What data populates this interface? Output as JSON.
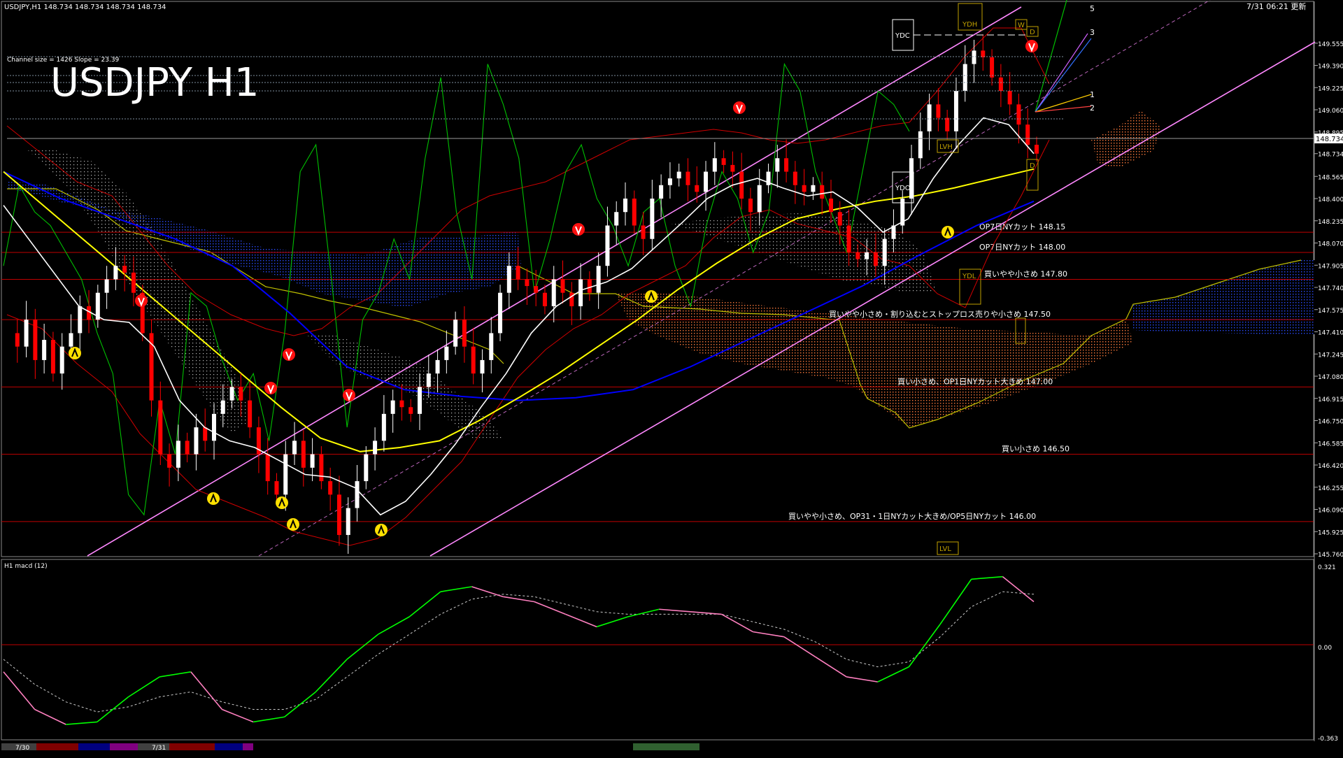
{
  "header": {
    "symbol_line": "USDJPY,H1  148.734 148.734 148.734 148.734",
    "update_label": "7/31 06:21 更新",
    "channel_info": "Channel size = 1426 Slope = 23.39",
    "big_title": "USDJPY H1"
  },
  "colors": {
    "background": "#000000",
    "grid": "#808080",
    "up_candle": "#ffffff",
    "down_candle": "#ff0000",
    "level_line": "#c00000",
    "channel": "#ff88ff",
    "ma_fast": "#ffffff",
    "ma_mid": "#ffff00",
    "ma_slow": "#0000ff",
    "chikou": "#00c000",
    "macd_up": "#00ff00",
    "macd_down": "#ff80c0",
    "signal": "#cccccc",
    "cloud_blue": "#2040ff",
    "cloud_orange": "#ff8040"
  },
  "chart_data": {
    "type": "candlestick",
    "symbol": "USDJPY",
    "timeframe": "H1",
    "ylim": [
      145.76,
      149.72
    ],
    "current_price": 148.734,
    "y_ticks": [
      "149.555",
      "149.390",
      "149.225",
      "149.060",
      "148.895",
      "148.734",
      "148.565",
      "148.400",
      "148.235",
      "148.070",
      "147.905",
      "147.740",
      "147.575",
      "147.410",
      "147.245",
      "147.080",
      "146.915",
      "146.750",
      "146.585",
      "146.420",
      "146.255",
      "146.090",
      "145.925",
      "145.760"
    ],
    "x_labels": [
      "7/30",
      "7/31"
    ],
    "levels": [
      {
        "price": 148.15,
        "label": "OP7日NYカット 148.15"
      },
      {
        "price": 148.0,
        "label": "OP7日NYカット 148.00"
      },
      {
        "price": 147.8,
        "label": "買いやや小さめ 147.80"
      },
      {
        "price": 147.5,
        "label": "買いやや小さめ・割り込むとストップロス売りや小さめ 147.50"
      },
      {
        "price": 147.0,
        "label": "買い小さめ、OP1日NYカット大きめ 147.00"
      },
      {
        "price": 146.5,
        "label": "買い小さめ 146.50"
      },
      {
        "price": 146.0,
        "label": "買いやや小さめ、OP31・1日NYカット大きめ/OP5日NYカット 146.00"
      }
    ],
    "box_labels": [
      "YDH",
      "YDC",
      "YDO",
      "YDL",
      "LVH",
      "LVL",
      "D",
      "W"
    ],
    "fan_labels": [
      "5",
      "3",
      "1",
      "2"
    ],
    "candles": [
      147.4,
      147.3,
      147.5,
      147.2,
      147.35,
      147.1,
      147.3,
      147.4,
      147.6,
      147.5,
      147.7,
      147.8,
      147.9,
      147.85,
      147.7,
      147.4,
      146.9,
      146.5,
      146.4,
      146.6,
      146.5,
      146.7,
      146.6,
      146.8,
      146.9,
      147.0,
      146.9,
      146.7,
      146.5,
      146.3,
      146.2,
      146.5,
      146.6,
      146.4,
      146.5,
      146.3,
      146.2,
      145.9,
      146.1,
      146.3,
      146.5,
      146.6,
      146.8,
      146.9,
      146.85,
      146.8,
      147.0,
      147.1,
      147.2,
      147.3,
      147.5,
      147.3,
      147.1,
      147.2,
      147.4,
      147.7,
      147.9,
      147.8,
      147.75,
      147.7,
      147.6,
      147.8,
      147.7,
      147.6,
      147.8,
      147.7,
      147.9,
      148.2,
      148.3,
      148.4,
      148.2,
      148.1,
      148.4,
      148.5,
      148.55,
      148.6,
      148.5,
      148.45,
      148.6,
      148.7,
      148.65,
      148.6,
      148.4,
      148.3,
      148.5,
      148.6,
      148.7,
      148.6,
      148.5,
      148.45,
      148.5,
      148.4,
      148.3,
      148.2,
      148.0,
      147.95,
      148.0,
      147.9,
      148.1,
      148.2,
      148.4,
      148.7,
      148.9,
      149.1,
      149.0,
      148.9,
      149.2,
      149.4,
      149.5,
      149.45,
      149.3,
      149.2,
      149.1,
      148.95,
      148.8,
      148.734
    ],
    "ma_fast": [
      148.35,
      148.1,
      147.85,
      147.6,
      147.5,
      147.48,
      147.3,
      146.9,
      146.7,
      146.6,
      146.55,
      146.45,
      146.35,
      146.33,
      146.25,
      146.05,
      146.15,
      146.35,
      146.58,
      146.85,
      147.1,
      147.4,
      147.6,
      147.72,
      147.78,
      147.88,
      148.05,
      148.22,
      148.4,
      148.5,
      148.55,
      148.48,
      148.42,
      148.45,
      148.33,
      148.15,
      148.25,
      148.55,
      148.8,
      149.0,
      148.95,
      148.734
    ],
    "ma_mid": [
      148.6,
      148.35,
      148.1,
      147.85,
      147.6,
      147.35,
      147.1,
      146.85,
      146.62,
      146.52,
      146.55,
      146.6,
      146.75,
      146.92,
      147.1,
      147.3,
      147.5,
      147.72,
      147.92,
      148.1,
      148.25,
      148.32,
      148.38,
      148.42,
      148.48,
      148.55,
      148.62
    ],
    "ma_slow": [
      148.6,
      148.4,
      148.25,
      148.1,
      147.9,
      147.55,
      147.15,
      146.98,
      146.93,
      146.9,
      146.92,
      146.98,
      147.15,
      147.35,
      147.55,
      147.75,
      147.98,
      148.2,
      148.38
    ],
    "chikou": [
      147.9,
      148.5,
      148.3,
      148.2,
      148.0,
      147.8,
      147.4,
      147.1,
      146.2,
      146.05,
      146.9,
      146.5,
      147.7,
      147.6,
      147.2,
      146.9,
      147.1,
      146.6,
      147.4,
      148.6,
      148.8,
      147.8,
      146.7,
      147.5,
      147.7,
      148.1,
      147.8,
      148.7,
      149.3,
      148.3,
      147.8,
      149.4,
      149.1,
      148.7,
      147.7,
      148.1,
      148.6,
      148.8,
      148.4,
      148.2,
      147.9,
      148.3,
      148.4,
      147.9,
      147.6,
      148.2,
      148.6,
      148.4,
      148.0,
      148.3,
      149.4,
      149.2,
      148.6,
      148.3,
      148.0,
      148.6,
      149.2,
      149.1,
      148.9
    ],
    "macd": {
      "label": "H1 macd (12)",
      "ylim": [
        -0.363,
        0.321
      ],
      "y_ticks": [
        "0.321",
        "0.00",
        "-0.363"
      ],
      "macd": [
        -0.1,
        -0.25,
        -0.31,
        -0.3,
        -0.2,
        -0.12,
        -0.1,
        -0.25,
        -0.3,
        -0.28,
        -0.18,
        -0.05,
        0.05,
        0.12,
        0.22,
        0.24,
        0.2,
        0.18,
        0.13,
        0.08,
        0.12,
        0.15,
        0.14,
        0.13,
        0.06,
        0.04,
        -0.04,
        -0.12,
        -0.14,
        -0.08,
        0.09,
        0.27,
        0.28,
        0.18
      ],
      "signal": [
        -0.05,
        -0.15,
        -0.22,
        -0.26,
        -0.24,
        -0.2,
        -0.18,
        -0.22,
        -0.25,
        -0.25,
        -0.21,
        -0.12,
        -0.03,
        0.05,
        0.13,
        0.19,
        0.21,
        0.2,
        0.17,
        0.14,
        0.13,
        0.13,
        0.13,
        0.13,
        0.1,
        0.07,
        0.02,
        -0.05,
        -0.08,
        -0.06,
        0.04,
        0.16,
        0.22,
        0.21
      ]
    }
  }
}
